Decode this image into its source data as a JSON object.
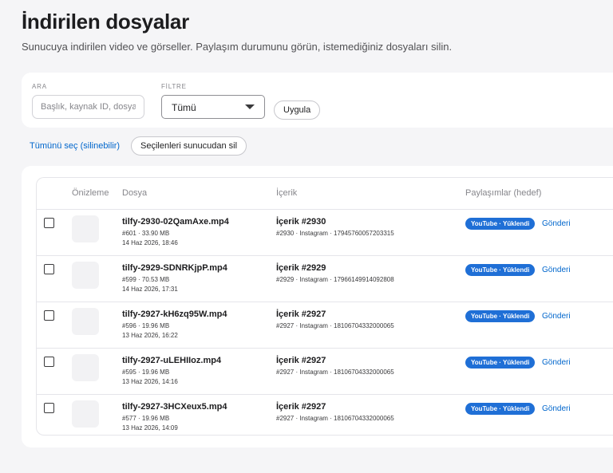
{
  "header": {
    "title": "İndirilen dosyalar",
    "subtitle": "Sunucuya indirilen video ve görseller. Paylaşım durumunu görün, istemediğiniz dosyaları silin."
  },
  "filters": {
    "search_label": "ARA",
    "search_placeholder": "Başlık, kaynak ID, dosya",
    "filter_label": "FİLTRE",
    "filter_value": "Tümü",
    "apply_label": "Uygula"
  },
  "bulk": {
    "select_all_label": "Tümünü seç (silinebilir)",
    "delete_selected_label": "Seçilenleri sunucudan sil"
  },
  "table": {
    "headers": [
      "Önizleme",
      "Dosya",
      "İçerik",
      "Paylaşımlar (hedef)"
    ],
    "rows": [
      {
        "file": "tilfy-2930-02QamAxe.mp4",
        "meta": "#601 · 33.90 MB",
        "date": "14 Haz 2026, 18:46",
        "content_title": "İçerik #2930",
        "content_meta": "#2930 · Instagram · 17945760057203315",
        "badge": "YouTube · Yüklendi",
        "link": "Gönderi"
      },
      {
        "file": "tilfy-2929-SDNRKjpP.mp4",
        "meta": "#599 · 70.53 MB",
        "date": "14 Haz 2026, 17:31",
        "content_title": "İçerik #2929",
        "content_meta": "#2929 · Instagram · 17966149914092808",
        "badge": "YouTube · Yüklendi",
        "link": "Gönderi"
      },
      {
        "file": "tilfy-2927-kH6zq95W.mp4",
        "meta": "#596 · 19.96 MB",
        "date": "13 Haz 2026, 16:22",
        "content_title": "İçerik #2927",
        "content_meta": "#2927 · Instagram · 18106704332000065",
        "badge": "YouTube · Yüklendi",
        "link": "Gönderi"
      },
      {
        "file": "tilfy-2927-uLEHIIoz.mp4",
        "meta": "#595 · 19.96 MB",
        "date": "13 Haz 2026, 14:16",
        "content_title": "İçerik #2927",
        "content_meta": "#2927 · Instagram · 18106704332000065",
        "badge": "YouTube · Yüklendi",
        "link": "Gönderi"
      },
      {
        "file": "tilfy-2927-3HCXeux5.mp4",
        "meta": "#577 · 19.96 MB",
        "date": "13 Haz 2026, 14:09",
        "content_title": "İçerik #2927",
        "content_meta": "#2927 · Instagram · 18106704332000065",
        "badge": "YouTube · Yüklendi",
        "link": "Gönderi"
      }
    ]
  },
  "colors": {
    "accent": "#1f6fd6",
    "link": "#0066cc",
    "background": "#f5f5f7"
  }
}
